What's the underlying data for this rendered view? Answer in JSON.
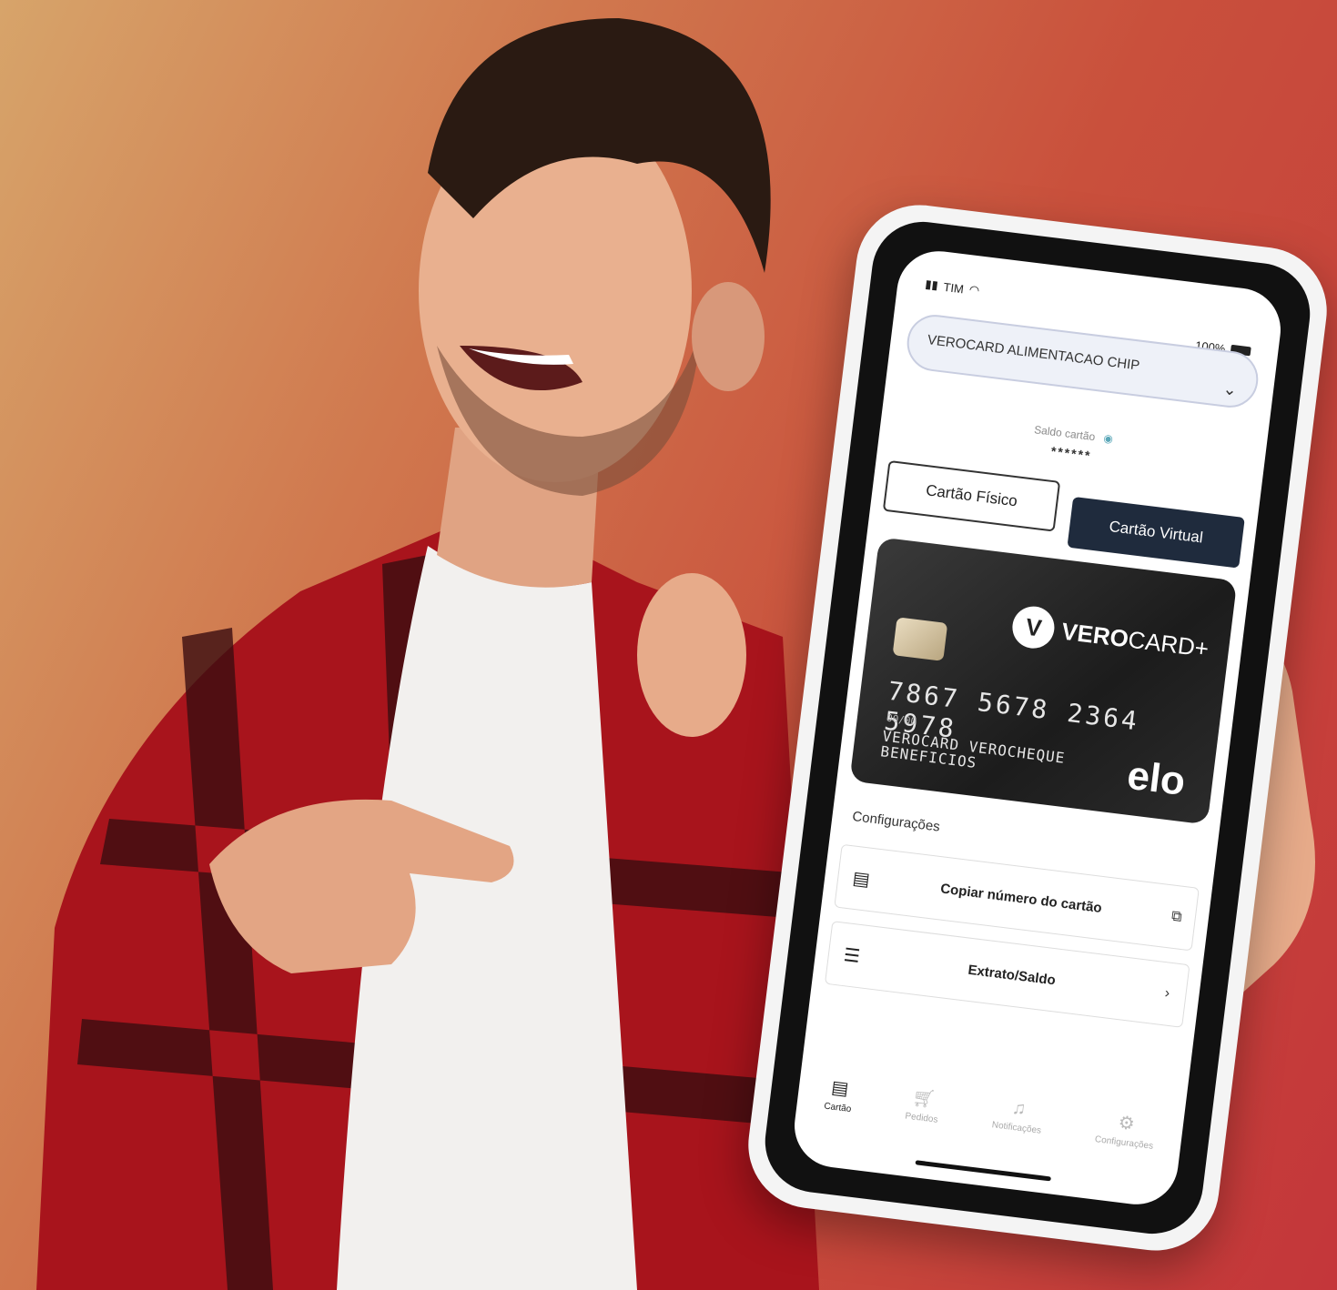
{
  "status_bar": {
    "carrier": "TIM",
    "battery": "100%"
  },
  "card_selector": {
    "label": "VEROCARD ALIMENTACAO CHIP"
  },
  "balance": {
    "label": "Saldo cartão",
    "value": "******"
  },
  "tabs": {
    "physical": "Cartão Físico",
    "virtual": "Cartão Virtual"
  },
  "card": {
    "brand": "VERO",
    "brand_suffix": "CARD+",
    "number": "7867 5678 2364 5978",
    "expiry": "00/00",
    "holder_line1": "VEROCARD VEROCHEQUE",
    "holder_line2": "BENEFICIOS",
    "network": "elo"
  },
  "settings": {
    "title": "Configurações",
    "copy_label": "Copiar número do cartão",
    "statement_label": "Extrato/Saldo"
  },
  "nav": {
    "card": "Cartão",
    "orders": "Pedidos",
    "notifications": "Notificações",
    "settings": "Configurações"
  },
  "icons": [
    "signal-icon",
    "wifi-icon",
    "battery-icon",
    "chevron-down-icon",
    "eye-icon",
    "wallet-icon",
    "copy-icon",
    "list-icon",
    "chevron-right-icon",
    "cart-icon",
    "bell-icon",
    "gear-icon"
  ],
  "colors": {
    "accent_dark": "#1f2b3d",
    "background": "#c9503c"
  }
}
